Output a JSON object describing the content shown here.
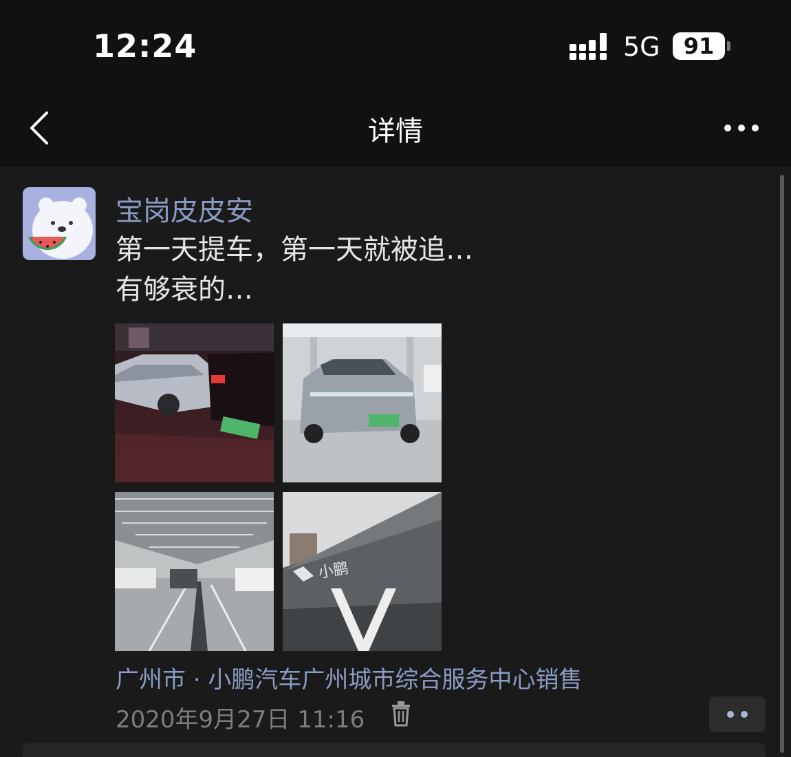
{
  "status_bar": {
    "time": "12:24",
    "network": "5G",
    "battery": "91"
  },
  "nav": {
    "title": "详情"
  },
  "post": {
    "author": "宝岗皮皮安",
    "text_lines": [
      "第一天提车，第一天就被追…",
      "有够衰的…"
    ],
    "photos": [
      {
        "subject": "night rear-end collision photo"
      },
      {
        "subject": "silver Xpeng car in showroom"
      },
      {
        "subject": "warehouse parking lot with cars"
      },
      {
        "subject": "Xpeng building facade"
      }
    ],
    "building_sign": "小鹏",
    "location": "广州市 · 小鹏汽车广州城市综合服务中心销售",
    "timestamp": "2020年9月27日 11:16"
  },
  "colors": {
    "link": "#8a9bc4",
    "background": "#1a1a1a",
    "bar": "#111111"
  }
}
